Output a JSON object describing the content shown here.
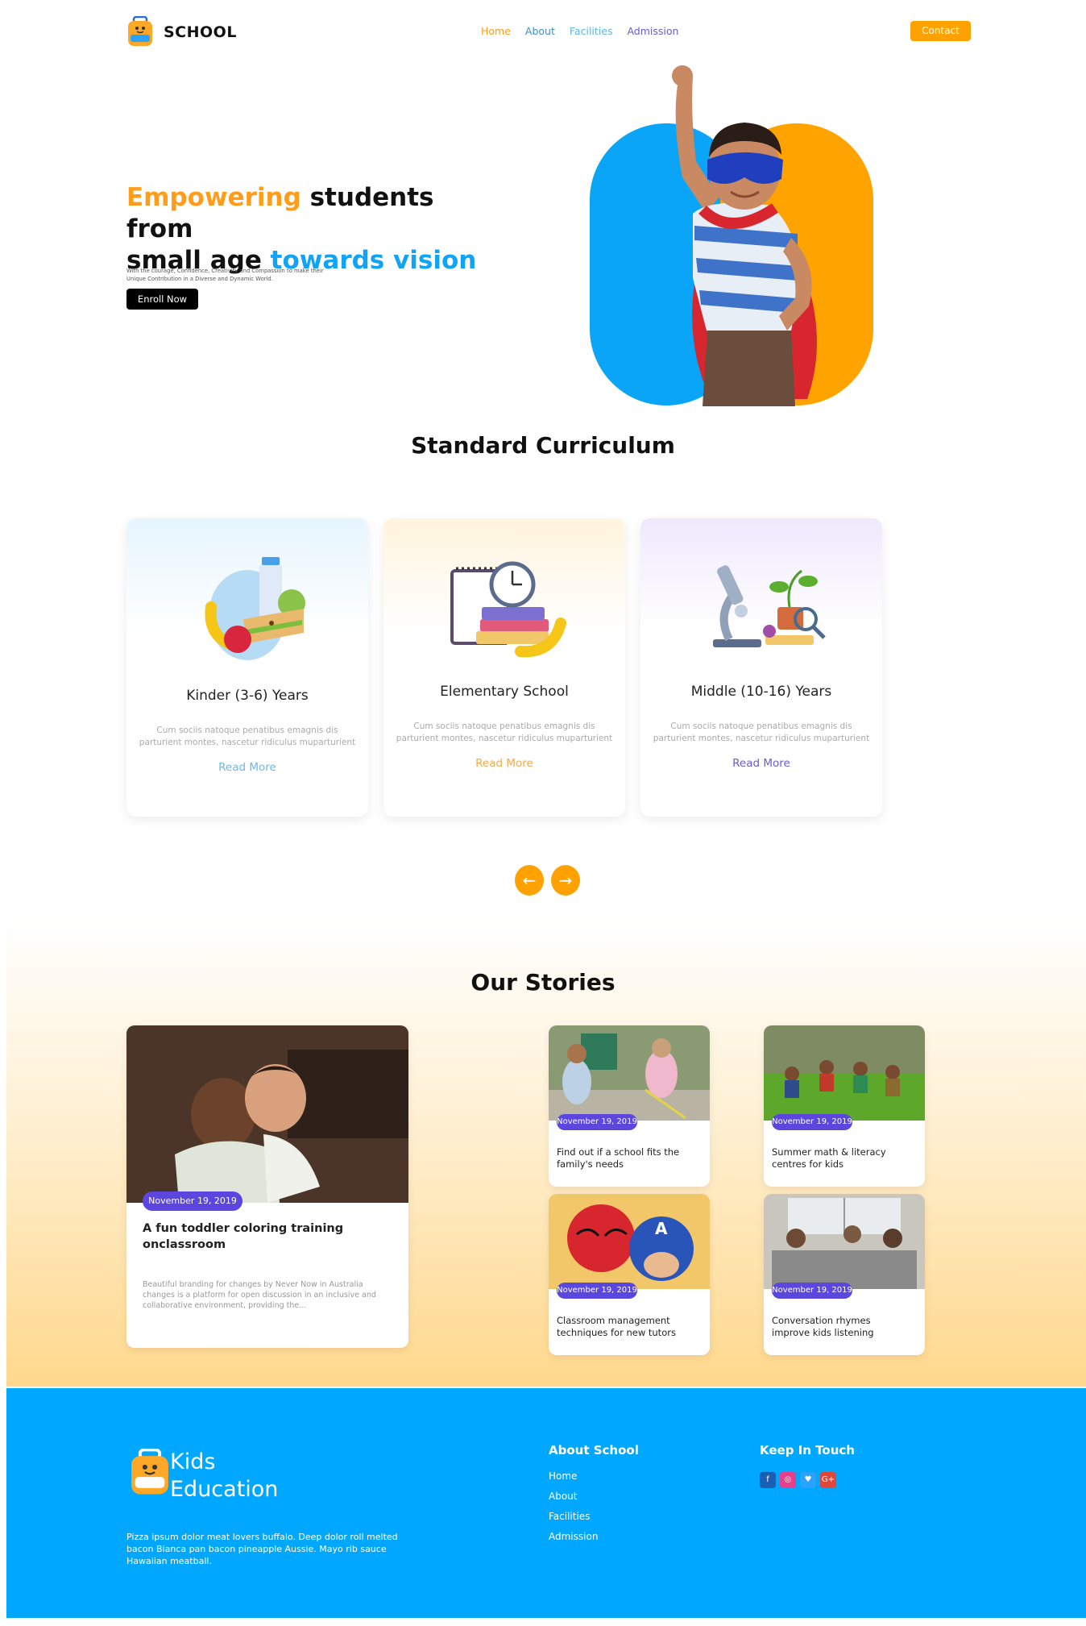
{
  "header": {
    "brand": "SCHOOL",
    "nav": [
      {
        "label": "Home",
        "color": "#ff9c1a"
      },
      {
        "label": "About",
        "color": "#3d8fcf"
      },
      {
        "label": "Facilities",
        "color": "#5fb6e8"
      },
      {
        "label": "Admission",
        "color": "#6a5bd6"
      }
    ],
    "contact_label": "Contact"
  },
  "hero": {
    "title_part1": "Empowering",
    "title_part2": " students from",
    "title_part3": "small age ",
    "title_part4": "towards vision",
    "description": "With the courage, Confidence, Creativity and Compassion to make their Unique Contribution in a Diverse and Dynamic World.",
    "enroll_label": "Enroll Now"
  },
  "curriculum": {
    "title": "Standard Curriculum",
    "cards": [
      {
        "title": "Kinder (3-6) Years",
        "description": "Cum sociis natoque penatibus emagnis dis parturient montes, nascetur ridiculus muparturient",
        "more": "Read More",
        "accent": "#6cb9ea"
      },
      {
        "title": "Elementary School",
        "description": "Cum sociis natoque penatibus emagnis dis parturient montes, nascetur ridiculus muparturient",
        "more": "Read More",
        "accent": "#f5a94a"
      },
      {
        "title": "Middle (10-16) Years",
        "description": "Cum sociis natoque penatibus emagnis dis parturient montes, nascetur ridiculus muparturient",
        "more": "Read More",
        "accent": "#6a5bd6"
      }
    ],
    "prev_icon": "←",
    "next_icon": "→"
  },
  "stories": {
    "title": "Our Stories",
    "featured": {
      "date": "November 19, 2019",
      "title": "A fun toddler coloring training onclassroom",
      "excerpt": "Beautiful branding for changes by Never Now in Australia changes is a platform for open discussion in an inclusive and collaborative environment, providing the..."
    },
    "items": [
      {
        "date": "November 19, 2019",
        "title": "Find out if a school fits the family's needs"
      },
      {
        "date": "November 19, 2019",
        "title": "Summer math & literacy centres for kids"
      },
      {
        "date": "November 19, 2019",
        "title": "Classroom management techniques for new tutors"
      },
      {
        "date": "November 19, 2019",
        "title": "Conversation rhymes improve kids listening"
      }
    ]
  },
  "footer": {
    "brand_line1": "Kids",
    "brand_line2": "Education",
    "description": "Pizza ipsum dolor meat lovers buffalo. Deep dolor roll melted bacon Bianca pan bacon pineapple Aussie. Mayo rib sauce Hawaiian meatball.",
    "about_heading": "About School",
    "links": [
      "Home",
      "About",
      "Facilities",
      "Admission"
    ],
    "keep_heading": "Keep In Touch",
    "social": [
      {
        "name": "facebook-icon",
        "glyph": "f",
        "color": "#1b5fb4"
      },
      {
        "name": "dribbble-icon",
        "glyph": "◎",
        "color": "#e4408c"
      },
      {
        "name": "twitter-icon",
        "glyph": "♥",
        "color": "#29a3ff"
      },
      {
        "name": "google-plus-icon",
        "glyph": "G+",
        "color": "#e0463a"
      }
    ]
  }
}
